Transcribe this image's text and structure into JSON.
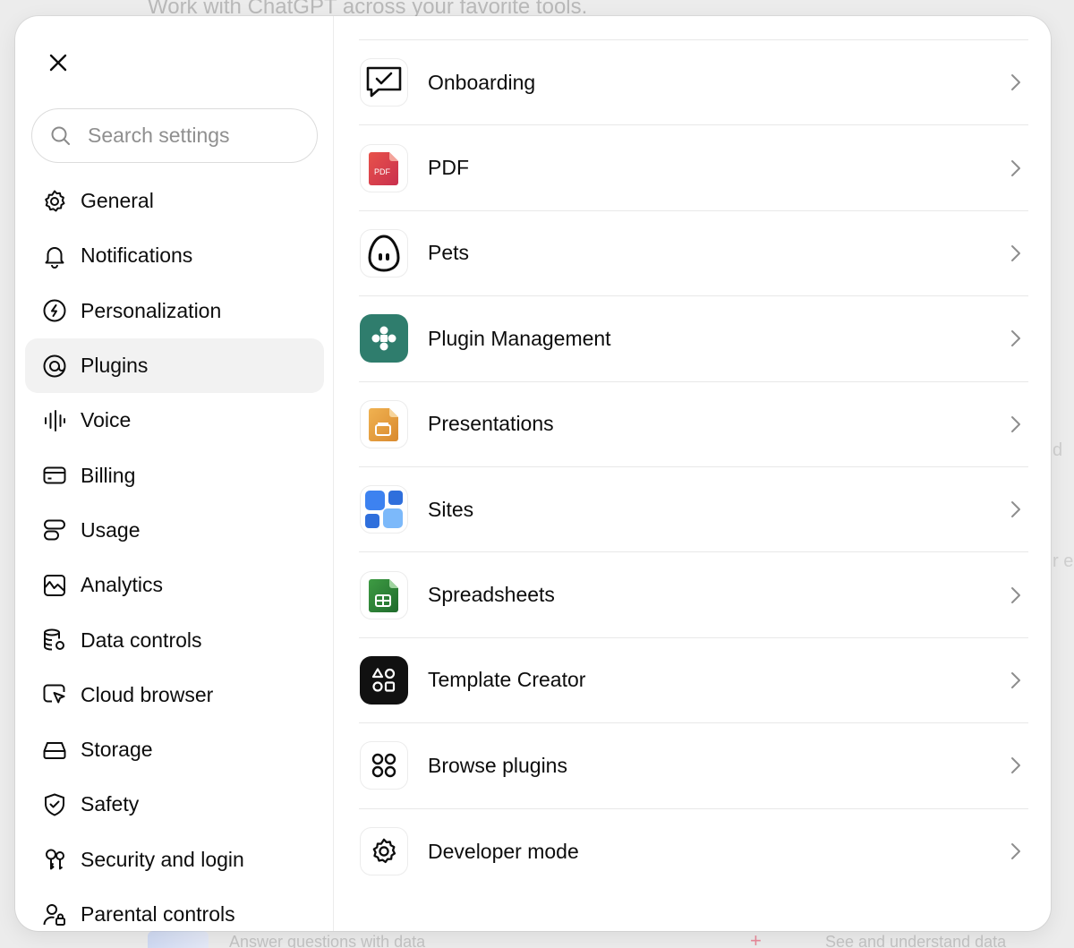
{
  "background": {
    "heading": "Work with ChatGPT across your favorite tools.",
    "footer_left": "Answer questions with data",
    "footer_right": "See and understand data"
  },
  "search": {
    "placeholder": "Search settings",
    "value": ""
  },
  "sidebar": {
    "items": [
      {
        "label": "General",
        "icon": "gear-icon"
      },
      {
        "label": "Notifications",
        "icon": "bell-icon"
      },
      {
        "label": "Personalization",
        "icon": "personalization-icon"
      },
      {
        "label": "Plugins",
        "icon": "plugins-icon",
        "active": true
      },
      {
        "label": "Voice",
        "icon": "waveform-icon"
      },
      {
        "label": "Billing",
        "icon": "card-icon"
      },
      {
        "label": "Usage",
        "icon": "usage-icon"
      },
      {
        "label": "Analytics",
        "icon": "analytics-icon"
      },
      {
        "label": "Data controls",
        "icon": "database-icon"
      },
      {
        "label": "Cloud browser",
        "icon": "cloud-browser-icon"
      },
      {
        "label": "Storage",
        "icon": "storage-icon"
      },
      {
        "label": "Safety",
        "icon": "shield-icon"
      },
      {
        "label": "Security and login",
        "icon": "security-icon"
      },
      {
        "label": "Parental controls",
        "icon": "parental-icon"
      }
    ]
  },
  "plugins": [
    {
      "label": "Onboarding",
      "icon": "chat-check-icon"
    },
    {
      "label": "PDF",
      "icon": "pdf-icon",
      "icon_text": "PDF"
    },
    {
      "label": "Pets",
      "icon": "pet-egg-icon"
    },
    {
      "label": "Plugin Management",
      "icon": "plugin-management-icon",
      "color": "#2f7d6d"
    },
    {
      "label": "Presentations",
      "icon": "presentations-icon",
      "color": "#e0a043"
    },
    {
      "label": "Sites",
      "icon": "sites-icon",
      "color": "#3d82f0"
    },
    {
      "label": "Spreadsheets",
      "icon": "spreadsheet-icon",
      "color": "#2e8a3a"
    },
    {
      "label": "Template Creator",
      "icon": "template-creator-icon",
      "color": "#111111"
    },
    {
      "label": "Browse plugins",
      "icon": "browse-grid-icon"
    },
    {
      "label": "Developer mode",
      "icon": "gear-icon"
    }
  ],
  "colors": {
    "active_bg": "#f2f2f2",
    "divider": "#e8e8e8",
    "placeholder": "#8f8f8f"
  }
}
